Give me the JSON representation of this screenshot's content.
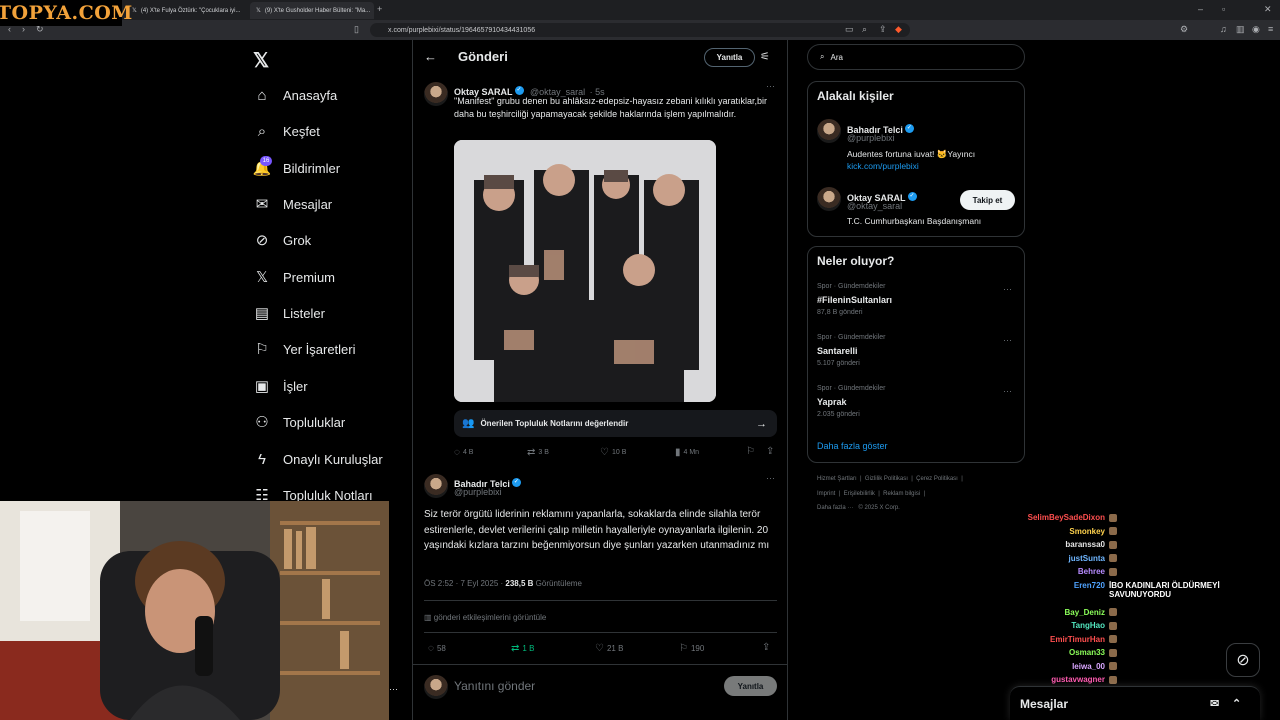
{
  "browser": {
    "watermark": "iTOPYA.COM",
    "tabs": [
      {
        "label": "(4) X'te Fulya Öztürk: \"Çocuklara iyi..."
      },
      {
        "label": "(9) X'te Gusholder Haber Bülteni: \"Ma..."
      }
    ],
    "url": "x.com/purplebixi/status/1964657910434431056"
  },
  "nav": {
    "items": [
      {
        "label": "Anasayfa",
        "icon": "home-icon"
      },
      {
        "label": "Keşfet",
        "icon": "search-icon"
      },
      {
        "label": "Bildirimler",
        "icon": "bell-icon"
      },
      {
        "label": "Mesajlar",
        "icon": "mail-icon"
      },
      {
        "label": "Grok",
        "icon": "grok-icon"
      },
      {
        "label": "Premium",
        "icon": "x-logo-icon"
      },
      {
        "label": "Listeler",
        "icon": "list-icon"
      },
      {
        "label": "Yer İşaretleri",
        "icon": "bookmark-icon"
      },
      {
        "label": "İşler",
        "icon": "briefcase-icon"
      },
      {
        "label": "Topluluklar",
        "icon": "people-icon"
      },
      {
        "label": "Onaylı Kuruluşlar",
        "icon": "lightning-icon"
      },
      {
        "label": "Topluluk Notları",
        "icon": "notes-icon"
      }
    ],
    "notification_badge": "16"
  },
  "header": {
    "title": "Gönderi",
    "reply_label": "Yanıtla"
  },
  "reply_tweet": {
    "name": "Oktay SARAL",
    "handle": "@oktay_saral",
    "time": "· 5s",
    "text": "\"Manifest\" grubu denen bu ahlâksız-edepsiz-hayasız zebani kılıklı yaratıklar,bir daha bu teşhirciliği yapamayacak şekilde haklarında işlem yapılmalıdır.",
    "notes_label": "Önerilen Topluluk Notlarını değerlendir",
    "actions": {
      "replies": "4 B",
      "reposts": "3 B",
      "likes": "10 B",
      "views": "4 Mn"
    }
  },
  "main_tweet": {
    "name": "Bahadır Telci",
    "handle": "@purplebixi",
    "text": "Siz terör örgütü liderinin reklamını yapanlarla, sokaklarda elinde silahla terör estirenlerle, devlet verilerini çalıp milletin hayalleriyle oynayanlarla ilgilenin. 20 yaşındaki kızlara tarzını beğenmiyorsun diye şunları yazarken utanmadınız mı",
    "time": "ÖS 2:52 · 7 Eyl 2025 ·",
    "views": "238,5 B",
    "views_label": "Görüntüleme",
    "engagement_link": "gönderi etkileşimlerini görüntüle",
    "actions": {
      "replies": "58",
      "reposts": "1 B",
      "likes": "21 B",
      "bookmarks": "190"
    }
  },
  "reply_box": {
    "placeholder": "Yanıtını gönder",
    "button": "Yanıtla"
  },
  "search": {
    "placeholder": "Ara"
  },
  "related": {
    "title": "Alakalı kişiler",
    "people": [
      {
        "name": "Bahadır Telci",
        "handle": "@purplebixi",
        "bio": "Audentes fortuna iuvat! 🐱Yayıncı",
        "link": "kick.com/purplebixi"
      },
      {
        "name": "Oktay SARAL",
        "handle": "@oktay_saral",
        "bio": "T.C. Cumhurbaşkanı Başdanışmanı",
        "follow": "Takip et"
      }
    ]
  },
  "trends": {
    "title": "Neler oluyor?",
    "items": [
      {
        "category": "Spor · Gündemdekiler",
        "name": "#FileninSultanları",
        "count": "87,8 B gönderi"
      },
      {
        "category": "Spor · Gündemdekiler",
        "name": "Santarelli",
        "count": "5.107 gönderi"
      },
      {
        "category": "Spor · Gündemdekiler",
        "name": "Yaprak",
        "count": "2.035 gönderi"
      }
    ],
    "show_more": "Daha fazla göster"
  },
  "footer": {
    "links": [
      "Hizmet Şartları",
      "Gizlilik Politikası",
      "Çerez Politikası",
      "Imprint",
      "Erişilebilirlik",
      "Reklam bilgisi"
    ],
    "more": "Daha fazla ···",
    "copyright": "© 2025 X Corp."
  },
  "chat": [
    {
      "user": "SelimBeySadeDixon",
      "color": "#ff4f4f",
      "msg": ""
    },
    {
      "user": "Smonkey",
      "color": "#ffd24d",
      "msg": ""
    },
    {
      "user": "baranssa0",
      "color": "#e6e6e6",
      "msg": ""
    },
    {
      "user": "justSunta",
      "color": "#6fb6ff",
      "msg": ""
    },
    {
      "user": "Behree",
      "color": "#b78bff",
      "msg": ""
    },
    {
      "user": "Eren720",
      "color": "#4fa3ff",
      "msg": "İBO KADINLARI ÖLDÜRMEYİ SAVUNUYORDU"
    },
    {
      "user": "Bay_Deniz",
      "color": "#8cff5a",
      "msg": ""
    },
    {
      "user": "TangHao",
      "color": "#53e8c0",
      "msg": ""
    },
    {
      "user": "EmirTimurHan",
      "color": "#ff4f4f",
      "msg": ""
    },
    {
      "user": "Osman33",
      "color": "#8cff5a",
      "msg": ""
    },
    {
      "user": "leiwa_00",
      "color": "#d9a6ff",
      "msg": ""
    },
    {
      "user": "gustavwagner",
      "color": "#ff5ab0",
      "msg": ""
    }
  ],
  "messages_bar": {
    "label": "Mesajlar"
  }
}
